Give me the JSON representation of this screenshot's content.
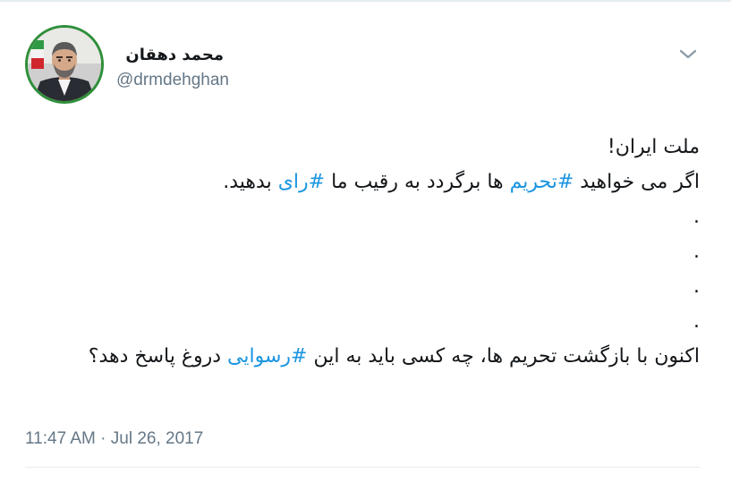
{
  "tweet": {
    "author": {
      "display_name": "محمد دهقان",
      "handle": "@drmdehghan"
    },
    "icons": {
      "menu": "chevron-down-icon",
      "avatar": "profile-photo"
    },
    "colors": {
      "hashtag": "#1b95e0",
      "avatar_border": "#2f8f3a",
      "secondary_text": "#657786"
    },
    "text": {
      "line1": "ملت ایران!",
      "line2_before": "اگر می خواهید ",
      "line2_tag1": "#تحریم",
      "line2_middle": " ها برگردد به رقیب ما ",
      "line2_tag2": "#رای",
      "line2_after": " بدهید.",
      "dot1": ".",
      "dot2": ".",
      "dot3": ".",
      "dot4": ".",
      "line7_before": "اکنون با بازگشت تحریم ها، چه کسی باید به این ",
      "line7_tag": "#رسوایی",
      "line7_after": " دروغ پاسخ دهد؟"
    },
    "timestamp": "11:47 AM · Jul 26, 2017"
  }
}
